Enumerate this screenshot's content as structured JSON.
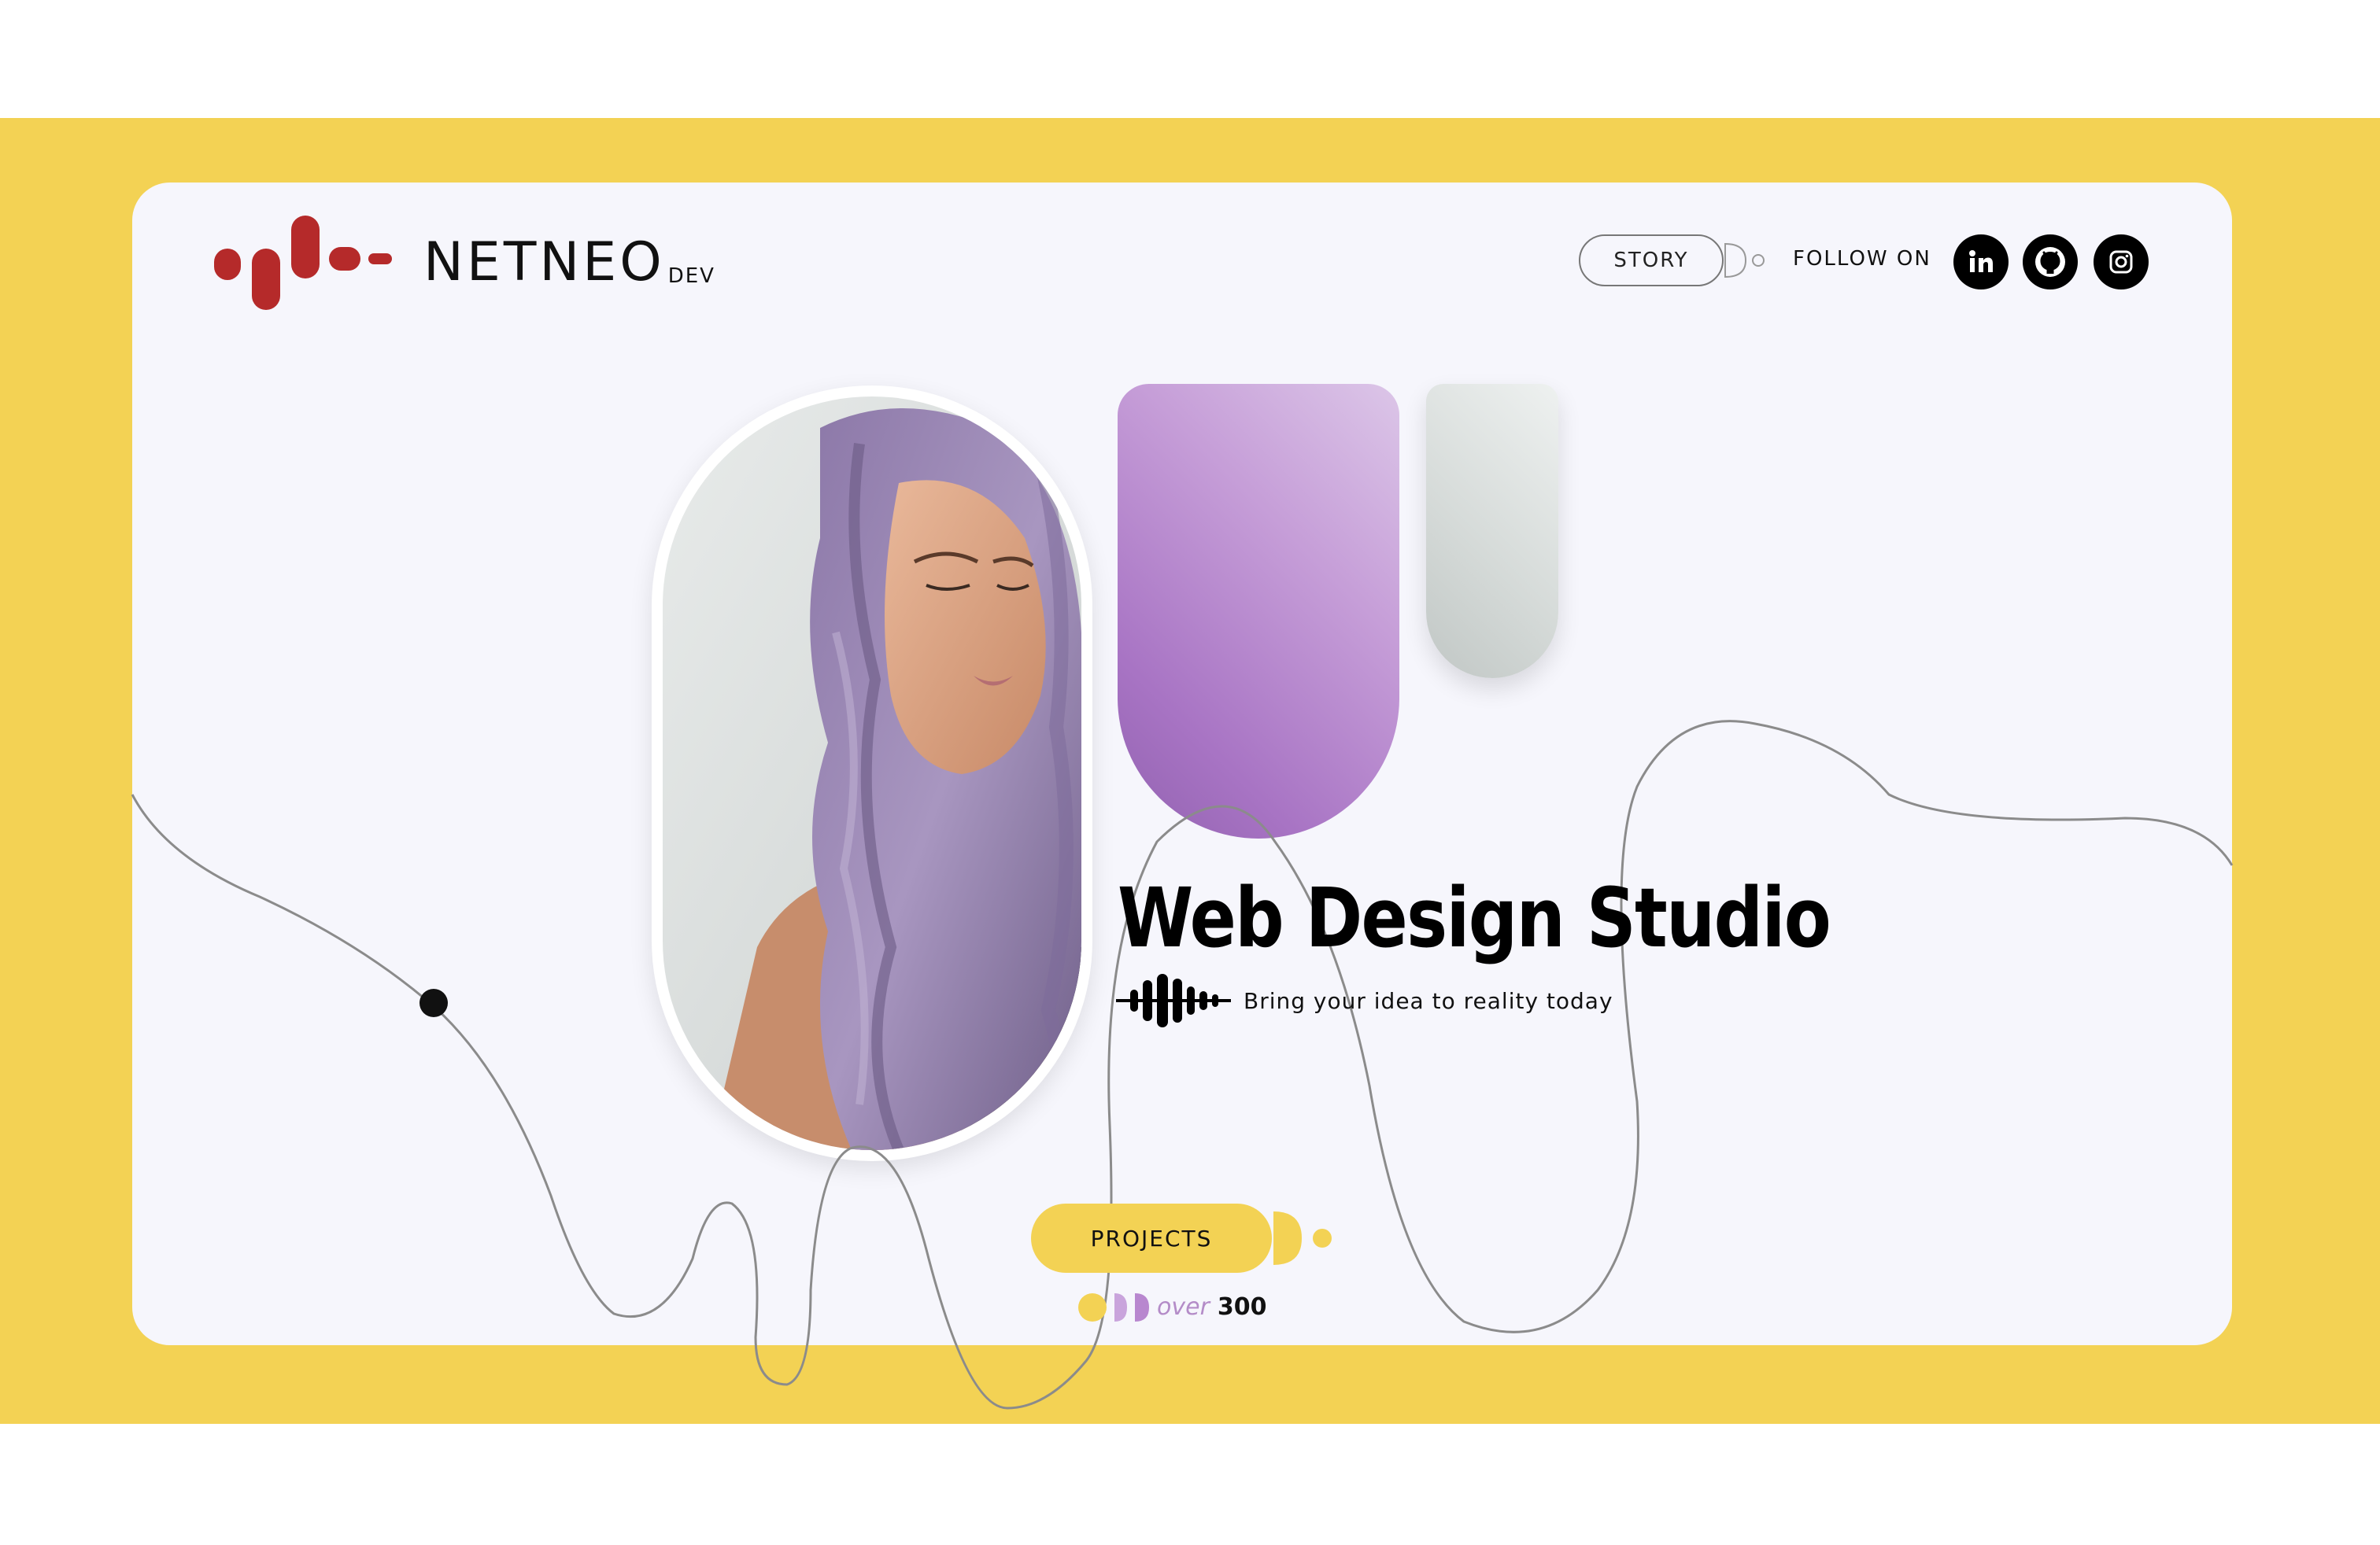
{
  "brand": {
    "name": "NETNEO",
    "suffix": "DEV"
  },
  "header": {
    "story_label": "STORY",
    "follow_label": "FOLLOW ON",
    "socials": [
      "linkedin-icon",
      "github-icon",
      "instagram-icon"
    ]
  },
  "hero": {
    "title": "Web Design Studio",
    "tagline": "Bring your idea to reality today"
  },
  "projects": {
    "button_label": "PROJECTS",
    "count_prefix": "over",
    "count_value": "300"
  },
  "colors": {
    "accent_yellow": "#f3d254",
    "brand_red": "#b52a2a",
    "purple": "#b887cf",
    "card_bg": "#f6f6fc"
  }
}
